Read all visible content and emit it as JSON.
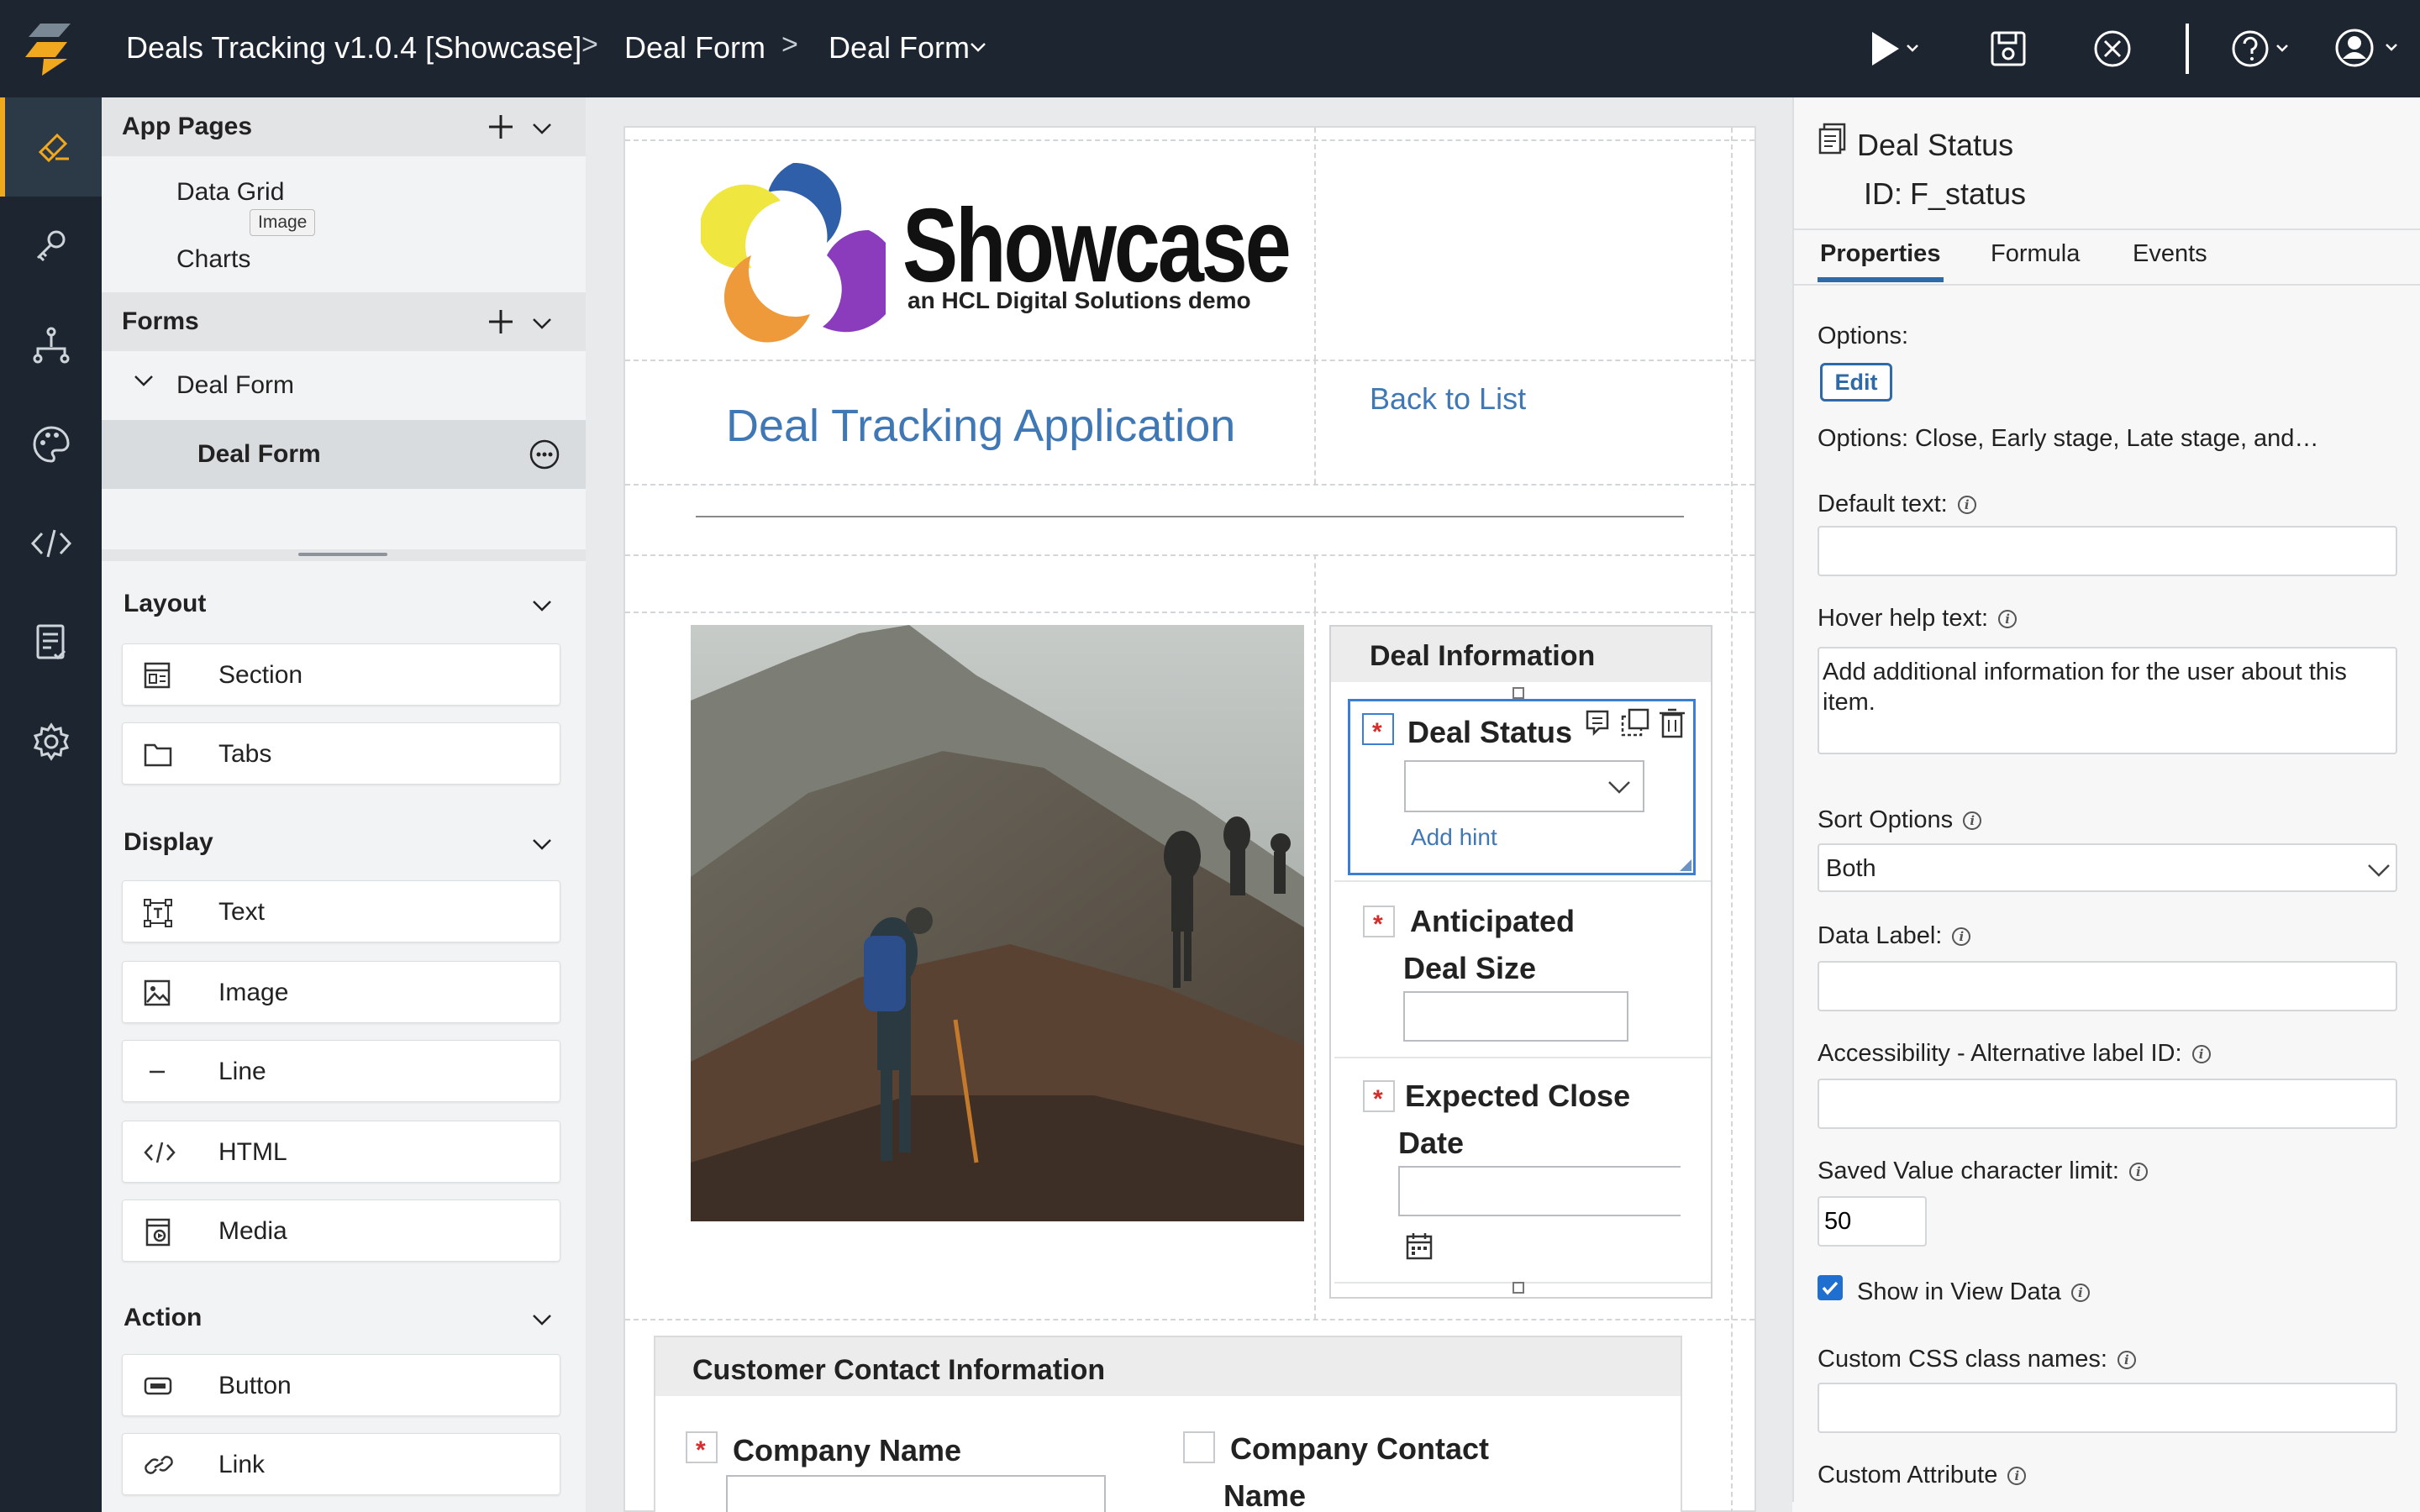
{
  "header": {
    "app_title": "Deals Tracking v1.0.4 [Showcase]",
    "crumb2": "Deal Form",
    "crumb3": "Deal Form",
    "separator": ">"
  },
  "palette": {
    "app_pages_title": "App Pages",
    "pages": [
      "Data Grid",
      "Charts"
    ],
    "tooltip": "Image",
    "forms_title": "Forms",
    "form_group": "Deal Form",
    "form_selected": "Deal Form",
    "layout_title": "Layout",
    "layout_items": [
      "Section",
      "Tabs"
    ],
    "display_title": "Display",
    "display_items": [
      "Text",
      "Image",
      "Line",
      "HTML",
      "Media"
    ],
    "action_title": "Action",
    "action_items": [
      "Button",
      "Link"
    ]
  },
  "canvas": {
    "logo_title": "Showcase",
    "logo_subtitle": "an HCL Digital Solutions demo",
    "app_heading": "Deal Tracking Application",
    "back_link": "Back to List",
    "deal_info_title": "Deal Information",
    "deal_status_label": "Deal Status",
    "add_hint": "Add hint",
    "deal_size_label_1": "Anticipated",
    "deal_size_label_2": "Deal Size",
    "close_date_label_1": "Expected Close",
    "close_date_label_2": "Date",
    "customer_section_title": "Customer Contact Information",
    "company_name_label": "Company Name",
    "company_contact_label_1": "Company Contact",
    "company_contact_label_2": "Name"
  },
  "properties": {
    "field_title": "Deal Status",
    "field_id_label": "ID:",
    "field_id": "F_status",
    "tabs": [
      "Properties",
      "Formula",
      "Events"
    ],
    "options_label": "Options:",
    "edit_button": "Edit",
    "options_summary": "Options: Close, Early stage, Late stage, and…",
    "default_text_label": "Default text:",
    "default_text_value": "",
    "hover_help_label": "Hover help text:",
    "hover_help_value": "Add additional information for the user about this item.",
    "sort_options_label": "Sort Options",
    "sort_options_value": "Both",
    "data_label_label": "Data Label:",
    "data_label_value": "",
    "a11y_label": "Accessibility - Alternative label ID:",
    "a11y_value": "",
    "char_limit_label": "Saved Value character limit:",
    "char_limit_value": "50",
    "show_in_view_label": "Show in View Data",
    "show_in_view_checked": true,
    "css_class_label": "Custom CSS class names:",
    "css_class_value": "",
    "custom_attr_label": "Custom Attribute"
  },
  "colors": {
    "accent": "#f0a81e",
    "link_blue": "#3f78b5",
    "topbar": "#1c2530",
    "checkbox_blue": "#1f6fd1"
  }
}
